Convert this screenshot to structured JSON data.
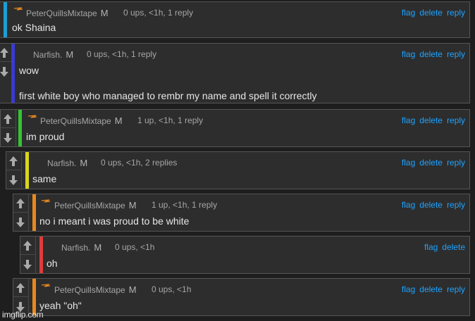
{
  "colors": {
    "background": "#1e1e1e",
    "card": "#2d2d2d",
    "link": "#1ea3ff",
    "username": "#a6a6a6",
    "body_text": "#e6e6e6",
    "bar_cyan": "#1b9fd4",
    "bar_blue": "#3a3ad6",
    "bar_green": "#33c433",
    "bar_yellow": "#d6d61e",
    "bar_orange": "#e8891e",
    "bar_red": "#e03b3b"
  },
  "icons": {
    "upvote": "arrow-up-icon",
    "downvote": "arrow-down-icon",
    "flair": "flair-icon"
  },
  "comments": [
    {
      "username": "PeterQuillsMixtape",
      "badge": "M",
      "meta": "0 ups, <1h, 1 reply",
      "actions": [
        "flag",
        "delete",
        "reply"
      ],
      "lines": [
        "ok Shaina"
      ]
    },
    {
      "username": "Narfish.",
      "badge": "M",
      "meta": "0 ups, <1h, 1 reply",
      "actions": [
        "flag",
        "delete",
        "reply"
      ],
      "lines": [
        "wow",
        "first white boy who managed to rembr my name and spell it correctly"
      ]
    },
    {
      "username": "PeterQuillsMixtape",
      "badge": "M",
      "meta": "1 up, <1h, 1 reply",
      "actions": [
        "flag",
        "delete",
        "reply"
      ],
      "lines": [
        "im proud"
      ]
    },
    {
      "username": "Narfish.",
      "badge": "M",
      "meta": "0 ups, <1h, 2 replies",
      "actions": [
        "flag",
        "delete",
        "reply"
      ],
      "lines": [
        "same"
      ]
    },
    {
      "username": "PeterQuillsMixtape",
      "badge": "M",
      "meta": "1 up, <1h, 1 reply",
      "actions": [
        "flag",
        "delete",
        "reply"
      ],
      "lines": [
        "no i meant i was proud to be white"
      ]
    },
    {
      "username": "Narfish.",
      "badge": "M",
      "meta": "0 ups, <1h",
      "actions": [
        "flag",
        "delete"
      ],
      "lines": [
        "oh"
      ]
    },
    {
      "username": "PeterQuillsMixtape",
      "badge": "M",
      "meta": "0 ups, <1h",
      "actions": [
        "flag",
        "delete",
        "reply"
      ],
      "lines": [
        "yeah \"oh\""
      ]
    }
  ],
  "watermark": "imgflip.com"
}
